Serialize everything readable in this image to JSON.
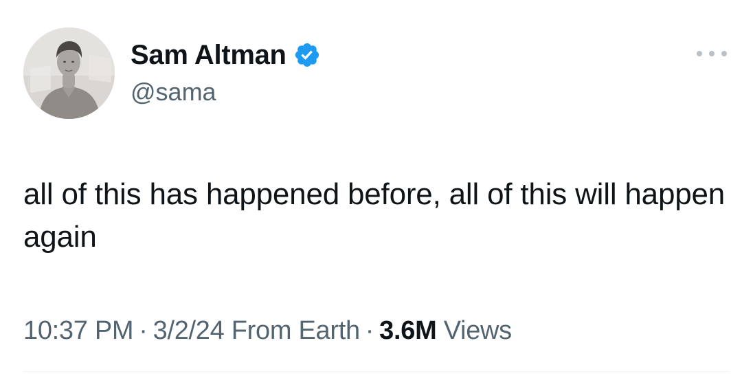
{
  "author": {
    "display_name": "Sam Altman",
    "handle": "@sama",
    "verified": true
  },
  "tweet": {
    "text": "all of this has happened before, all of this will happen again",
    "time": "10:37 PM",
    "date": "3/2/24",
    "source": "From Earth",
    "views_count": "3.6M",
    "views_label": "Views",
    "separator": "·"
  },
  "icons": {
    "verified": "verified-badge-icon",
    "more": "more-options-icon"
  },
  "colors": {
    "verified_blue": "#1d9bf0",
    "primary_text": "#0f1419",
    "secondary_text": "#536471"
  }
}
